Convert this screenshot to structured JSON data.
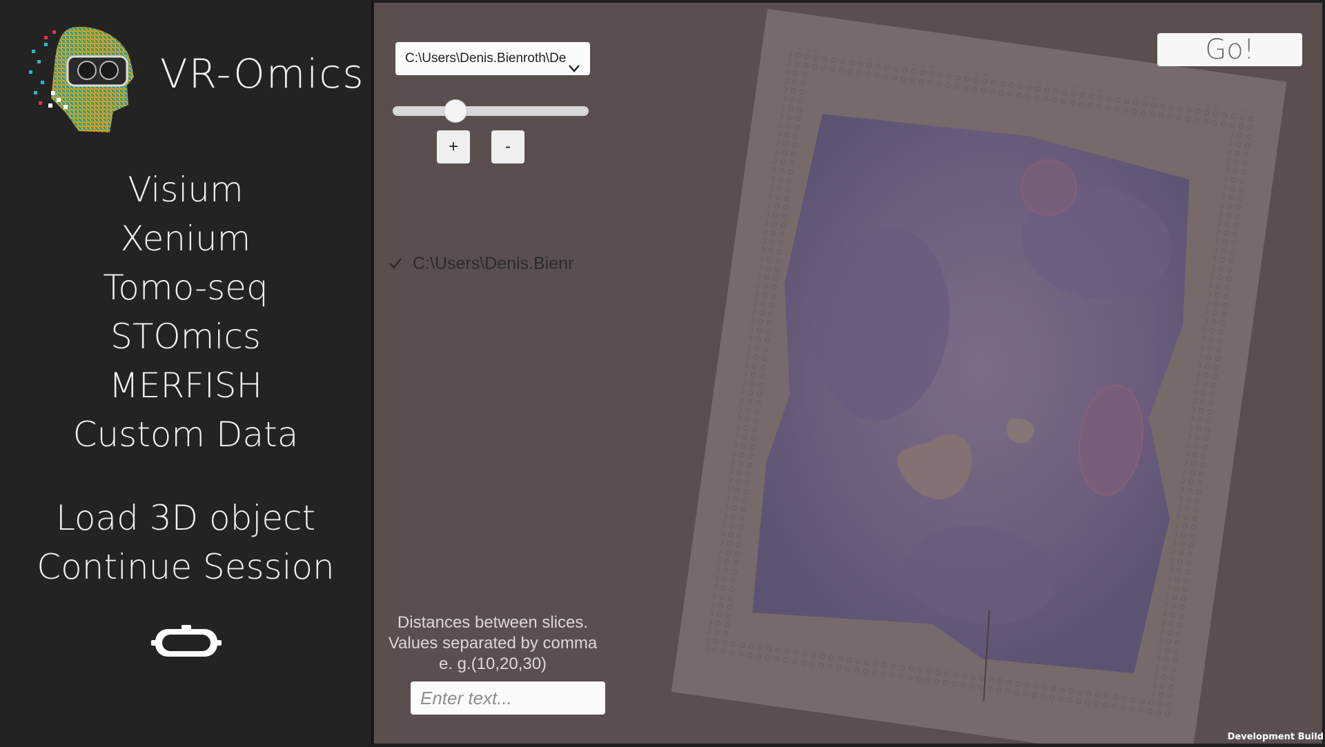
{
  "app": {
    "title": "VR-Omics"
  },
  "sidebar": {
    "menu": [
      {
        "label": "Visium"
      },
      {
        "label": "Xenium"
      },
      {
        "label": "Tomo-seq"
      },
      {
        "label": "STOmics"
      },
      {
        "label": "MERFISH"
      },
      {
        "label": "Custom Data"
      }
    ],
    "extra_menu": [
      {
        "label": "Load 3D object"
      },
      {
        "label": "Continue Session"
      }
    ],
    "vr_headset_icon": "vr-headset-icon"
  },
  "main": {
    "path_dropdown": {
      "selected": "C:\\Users\\Denis.Bienroth\\De"
    },
    "slider": {
      "value_fraction": 0.32
    },
    "plus_label": "+",
    "minus_label": "-",
    "checked_item": {
      "label": "C:\\Users\\Denis.Bienr",
      "checked": true
    },
    "distances": {
      "label_line1": "Distances between slices.",
      "label_line2": "Values separated by comma",
      "label_line3": "e. g.(10,20,30)",
      "placeholder": "Enter text...",
      "value": ""
    },
    "go_label": "Go!"
  },
  "footer": {
    "build_label": "Development Build"
  },
  "colors": {
    "sidebar_bg": "#232323",
    "main_bg": "#5a4f4e",
    "text_light": "#f0f0f0"
  }
}
